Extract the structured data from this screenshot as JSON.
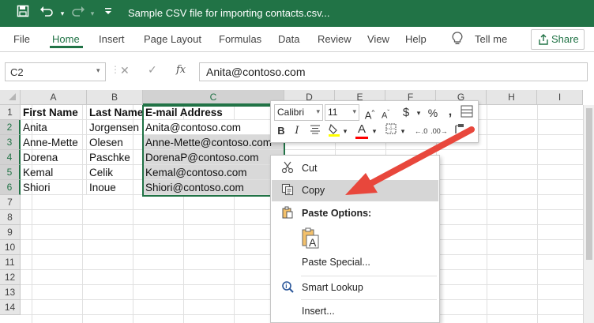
{
  "titlebar": {
    "title": "Sample CSV file for importing contacts.csv...",
    "icons": [
      "save-icon",
      "undo-icon",
      "undo-dropdown-icon",
      "redo-icon",
      "redo-dropdown-icon",
      "customize-toolbar-icon"
    ]
  },
  "menu": {
    "items": [
      "File",
      "Home",
      "Insert",
      "Page Layout",
      "Formulas",
      "Data",
      "Review",
      "View",
      "Help"
    ],
    "active": "Home",
    "tell_me": "Tell me",
    "share": "Share"
  },
  "formula_bar": {
    "name_box": "C2",
    "fx": "fx",
    "value": "Anita@contoso.com"
  },
  "grid": {
    "columns": [
      "A",
      "B",
      "C",
      "D",
      "E",
      "F",
      "G",
      "H",
      "I"
    ],
    "rows": [
      "1",
      "2",
      "3",
      "4",
      "5",
      "6",
      "7",
      "8",
      "9",
      "10",
      "11",
      "12",
      "13",
      "14"
    ],
    "header_row": [
      "First Name",
      "Last Name",
      "E-mail Address"
    ],
    "data_rows": [
      [
        "Anita",
        "Jorgensen",
        "Anita@contoso.com"
      ],
      [
        "Anne-Mette",
        "Olesen",
        "Anne-Mette@contoso.com"
      ],
      [
        "Dorena",
        "Paschke",
        "DorenaP@contoso.com"
      ],
      [
        "Kemal",
        "Celik",
        "Kemal@contoso.com"
      ],
      [
        "Shiori",
        "Inoue",
        "Shiori@contoso.com"
      ]
    ]
  },
  "mini_toolbar": {
    "font": "Calibri",
    "size": "11",
    "bold": "B",
    "italic": "I",
    "font_color_letter": "A",
    "highlight_color": "#ffff00",
    "font_color": "#ff0000"
  },
  "context_menu": {
    "cut": "Cut",
    "copy": "Copy",
    "paste_options": "Paste Options:",
    "paste_special": "Paste Special...",
    "smart_lookup": "Smart Lookup",
    "insert": "Insert..."
  },
  "colors": {
    "excel_green": "#217346",
    "arrow": "#e8473c"
  }
}
